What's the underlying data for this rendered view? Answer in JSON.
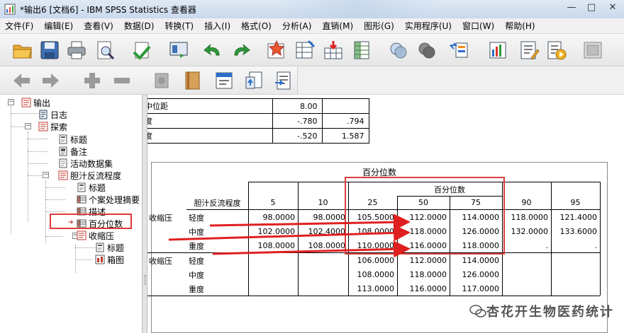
{
  "window": {
    "title": "*输出6 [文档6] - IBM SPSS Statistics 查看器",
    "controls": [
      "—",
      "□",
      "✕"
    ]
  },
  "menu": [
    "文件(F)",
    "编辑(E)",
    "查看(V)",
    "数据(D)",
    "转换(T)",
    "插入(I)",
    "格式(O)",
    "分析(A)",
    "直销(M)",
    "图形(G)",
    "实用程序(U)",
    "窗口(W)",
    "帮助(H)"
  ],
  "toolbar1_icons": [
    "open-folder-icon",
    "save-icon",
    "print-icon",
    "print-preview-icon",
    "export-icon",
    "recall-dialog-icon",
    "undo-icon",
    "redo-icon",
    "goto-data-icon",
    "goto-case-icon",
    "goto-variable-icon",
    "variables-icon",
    "select-cases-icon",
    "show-all-icon",
    "designate-window-icon",
    "insert-output-icon",
    "insert-title-icon",
    "insert-text-icon",
    "run-script-icon",
    "outline-icon"
  ],
  "toolbar2_icons": [
    "back-arrow-icon",
    "forward-arrow-icon",
    "expand-plus-icon",
    "collapse-minus-icon",
    "hide-icon",
    "book-icon",
    "insert-heading-icon",
    "insert-page-icon",
    "insert-text-file-icon"
  ],
  "tree": {
    "root": "输出",
    "nodes": [
      {
        "label": "日志"
      },
      {
        "label": "探索"
      },
      {
        "label": "标题"
      },
      {
        "label": "备注"
      },
      {
        "label": "活动数据集"
      },
      {
        "label": "胆汁反流程度"
      },
      {
        "label": "标题"
      },
      {
        "label": "个案处理摘要"
      },
      {
        "label": "描述"
      },
      {
        "label": "百分位数"
      },
      {
        "label": "收缩压"
      },
      {
        "label": "标题"
      },
      {
        "label": "箱图"
      }
    ]
  },
  "top_table": {
    "rows": [
      {
        "label": "中位距",
        "col1": "8.00",
        "col2": ""
      },
      {
        "label": "度",
        "col1": "-.780",
        "col2": ".794"
      },
      {
        "label": "度",
        "col1": "-.520",
        "col2": "1.587"
      }
    ]
  },
  "percentile_table": {
    "title": "百分位数",
    "group_header": "百分位数",
    "row_dim_label": "胆汁反流程度",
    "columns": [
      "5",
      "10",
      "25",
      "50",
      "75",
      "90",
      "95"
    ],
    "block1": {
      "var": "收缩压",
      "rows": [
        {
          "level": "轻度",
          "values": [
            "98.0000",
            "98.0000",
            "105.5000",
            "112.0000",
            "114.0000",
            "118.0000",
            "121.4000"
          ]
        },
        {
          "level": "中度",
          "values": [
            "102.0000",
            "102.4000",
            "108.0000",
            "118.0000",
            "126.0000",
            "132.0000",
            "133.6000"
          ]
        },
        {
          "level": "重度",
          "values": [
            "108.0000",
            "108.0000",
            "110.0000",
            "116.0000",
            "118.0000",
            ".",
            "."
          ]
        }
      ]
    },
    "block2": {
      "var": "收缩压",
      "rows": [
        {
          "level": "轻度",
          "values": [
            "",
            "",
            "106.0000",
            "112.0000",
            "114.0000",
            "",
            ""
          ]
        },
        {
          "level": "中度",
          "values": [
            "",
            "",
            "108.0000",
            "118.0000",
            "126.0000",
            "",
            ""
          ]
        },
        {
          "level": "重度",
          "values": [
            "",
            "",
            "113.0000",
            "116.0000",
            "117.0000",
            "",
            ""
          ]
        }
      ]
    }
  },
  "watermark": "杏花开生物医药统计",
  "colors": {
    "annotation_red": "#e23a3a",
    "spss_red": "#c0392b"
  }
}
